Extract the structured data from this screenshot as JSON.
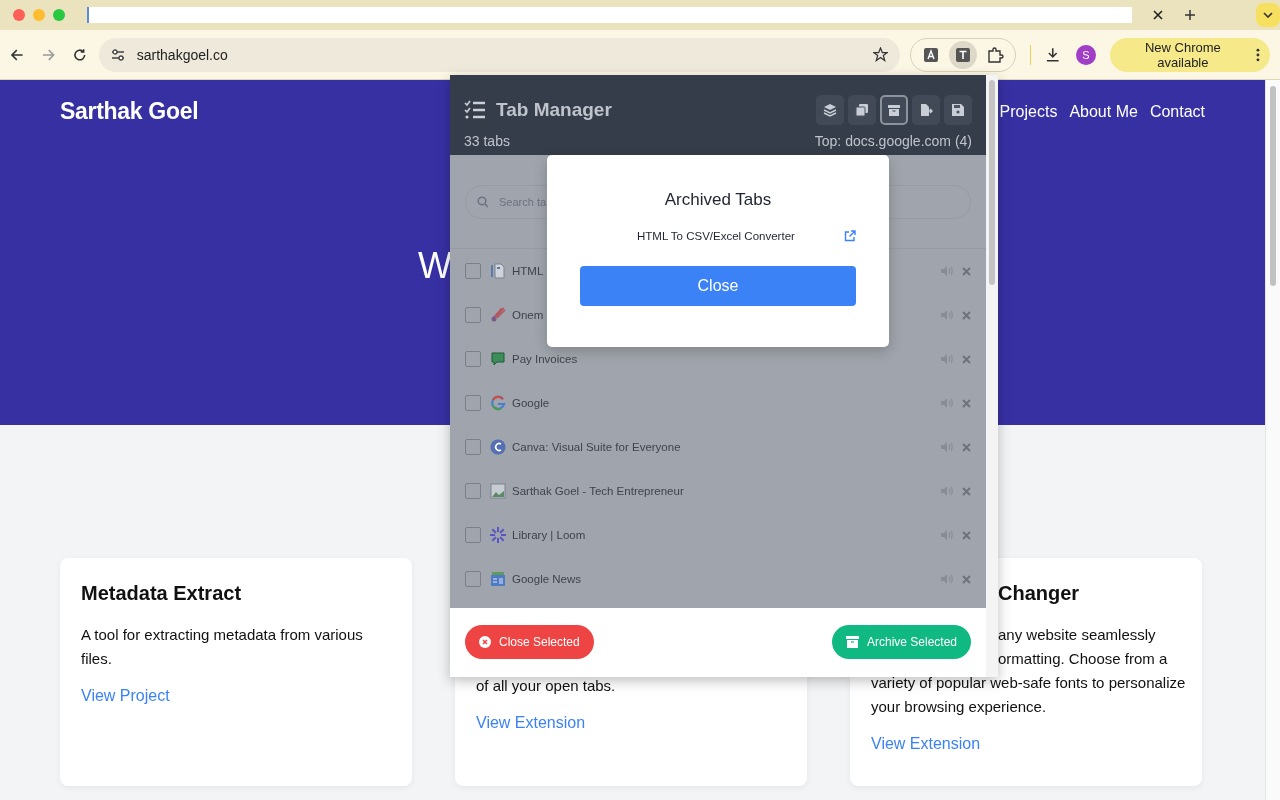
{
  "browser": {
    "address": "sarthakgoel.co",
    "extensions": [
      {
        "kind": "a",
        "selected": false
      },
      {
        "kind": "t",
        "selected": true
      },
      {
        "kind": "puzzle",
        "selected": false
      }
    ],
    "avatar": "S",
    "update_label": "New Chrome available"
  },
  "site": {
    "brand": "Sarthak Goel",
    "nav": [
      "Projects",
      "About Me",
      "Contact"
    ],
    "hero_title": "W",
    "cards": [
      {
        "heading": "Metadata Extract",
        "lines": [
          "A tool for extracting metadata from various",
          "files."
        ],
        "link": "View Project"
      },
      {
        "lines": [
          "of all your open tabs."
        ],
        "link": "View Extension"
      },
      {
        "heading": "Changer",
        "lines": [
          "any website seamlessly",
          "ormatting. Choose from a",
          "variety of popular web-safe fonts to personalize",
          "your browsing experience."
        ],
        "link": "View Extension"
      }
    ]
  },
  "popup": {
    "title": "Tab Manager",
    "count": "33 tabs",
    "top_domain": "Top: docs.google.com (4)",
    "tools": [
      {
        "kind": "layers",
        "selected": false
      },
      {
        "kind": "copy",
        "selected": false
      },
      {
        "kind": "archive",
        "selected": true
      },
      {
        "kind": "export",
        "selected": false
      },
      {
        "kind": "save",
        "selected": false
      }
    ],
    "search": {
      "placeholder": "Search ta"
    },
    "tabs": [
      {
        "title": "HTML",
        "kind": "doc",
        "checked": false
      },
      {
        "title": "Onem",
        "kind": "brush",
        "checked": false
      },
      {
        "title": "Pay Invoices",
        "kind": "chat",
        "checked": false
      },
      {
        "title": "Google",
        "kind": "g",
        "checked": false
      },
      {
        "title": "Canva: Visual Suite for Everyone",
        "kind": "c",
        "checked": false
      },
      {
        "title": "Sarthak Goel - Tech Entrepreneur",
        "kind": "image",
        "checked": false
      },
      {
        "title": "Library | Loom",
        "kind": "burst",
        "checked": false
      },
      {
        "title": "Google News",
        "kind": "news",
        "checked": false
      }
    ],
    "close_selected": "Close Selected",
    "archive_selected": "Archive Selected",
    "dialog": {
      "title": "Archived Tabs",
      "items": [
        "HTML To CSV/Excel Converter"
      ],
      "close": "Close"
    }
  }
}
